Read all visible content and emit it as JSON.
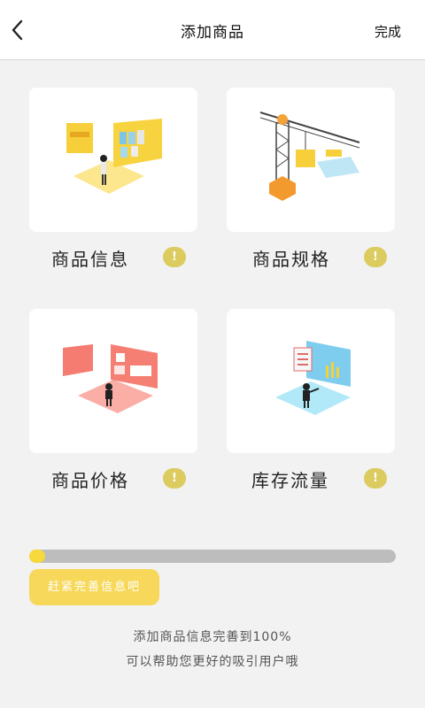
{
  "header": {
    "title": "添加商品",
    "done_label": "完成"
  },
  "cards": [
    {
      "label": "商品信息",
      "badge": "!"
    },
    {
      "label": "商品规格",
      "badge": "!"
    },
    {
      "label": "商品价格",
      "badge": "!"
    },
    {
      "label": "库存流量",
      "badge": "!"
    }
  ],
  "progress": {
    "fraction": 0.03,
    "color": "#f7d83d"
  },
  "cta": {
    "label": "赶紧完善信息吧"
  },
  "hint": {
    "line1": "添加商品信息完善到100%",
    "line2": "可以帮助您更好的吸引用户哦"
  },
  "colors": {
    "accent": "#f7d85a",
    "badge": "#dccb5f",
    "track": "#bdbdbd"
  },
  "icons": {
    "back": "chevron-left-icon"
  }
}
